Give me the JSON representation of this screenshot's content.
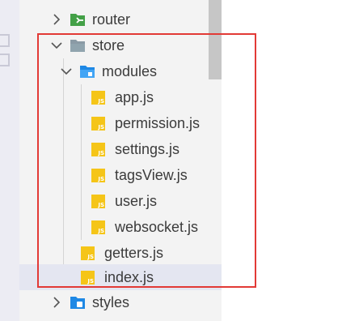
{
  "tree": {
    "router": {
      "label": "router",
      "icon": "router-folder-icon"
    },
    "store": {
      "label": "store",
      "icon": "folder-open-icon"
    },
    "modules": {
      "label": "modules",
      "icon": "modules-folder-open-icon"
    },
    "module_files": [
      {
        "label": "app.js"
      },
      {
        "label": "permission.js"
      },
      {
        "label": "settings.js"
      },
      {
        "label": "tagsView.js"
      },
      {
        "label": "user.js"
      },
      {
        "label": "websocket.js"
      }
    ],
    "store_files": [
      {
        "label": "getters.js"
      },
      {
        "label": "index.js"
      }
    ],
    "styles": {
      "label": "styles",
      "icon": "styles-folder-icon"
    },
    "js_badge": "JS"
  },
  "colors": {
    "highlight_border": "#e23a36",
    "js_icon": "#f5c518",
    "selected_row": "#e4e6f1"
  }
}
